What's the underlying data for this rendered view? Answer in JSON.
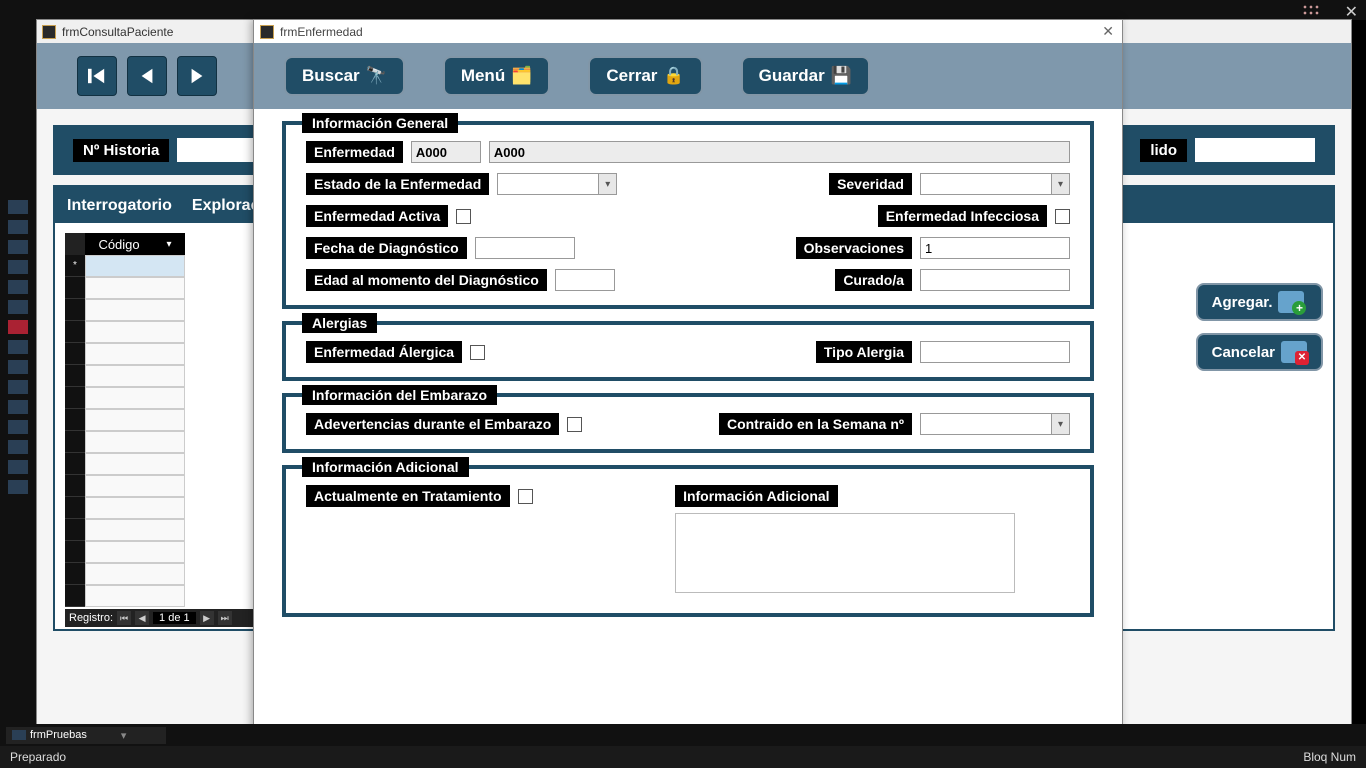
{
  "bg": {
    "title": "frmConsultaPaciente",
    "tabs": [
      "Interrogatorio",
      "Exploraci"
    ],
    "header": {
      "historia_label": "Nº Historia",
      "apellido_label": "lido"
    },
    "grid": {
      "col1": "Código",
      "rowmark": "*"
    },
    "record_nav": {
      "label": "Registro:",
      "position": "1 de 1"
    },
    "buttons": {
      "agregar": "Agregar.",
      "cancelar": "Cancelar"
    }
  },
  "fg": {
    "title": "frmEnfermedad",
    "toolbar": {
      "buscar": "Buscar",
      "menu": "Menú",
      "cerrar": "Cerrar",
      "guardar": "Guardar"
    },
    "g1": {
      "legend": "Información General",
      "enfermedad_lbl": "Enfermedad",
      "enfermedad_code": "A000",
      "enfermedad_name": "A000",
      "estado_lbl": "Estado de la Enfermedad",
      "severidad_lbl": "Severidad",
      "activa_lbl": "Enfermedad Activa",
      "infecciosa_lbl": "Enfermedad Infecciosa",
      "fecha_diag_lbl": "Fecha de Diagnóstico",
      "observ_lbl": "Observaciones",
      "observ_val": "1",
      "edad_diag_lbl": "Edad al momento del Diagnóstico",
      "curado_lbl": "Curado/a"
    },
    "g2": {
      "legend": "Alergias",
      "alergica_lbl": "Enfermedad Álergica",
      "tipo_lbl": "Tipo Alergia"
    },
    "g3": {
      "legend": "Información del Embarazo",
      "advert_lbl": "Adevertencias durante el Embarazo",
      "semana_lbl": "Contraido en la Semana nº"
    },
    "g4": {
      "legend": "Información Adicional",
      "tratamiento_lbl": "Actualmente en Tratamiento",
      "info_lbl": "Información Adicional"
    }
  },
  "taskbar": {
    "item": "frmPruebas"
  },
  "status": {
    "left": "Preparado",
    "right": "Bloq Num"
  }
}
